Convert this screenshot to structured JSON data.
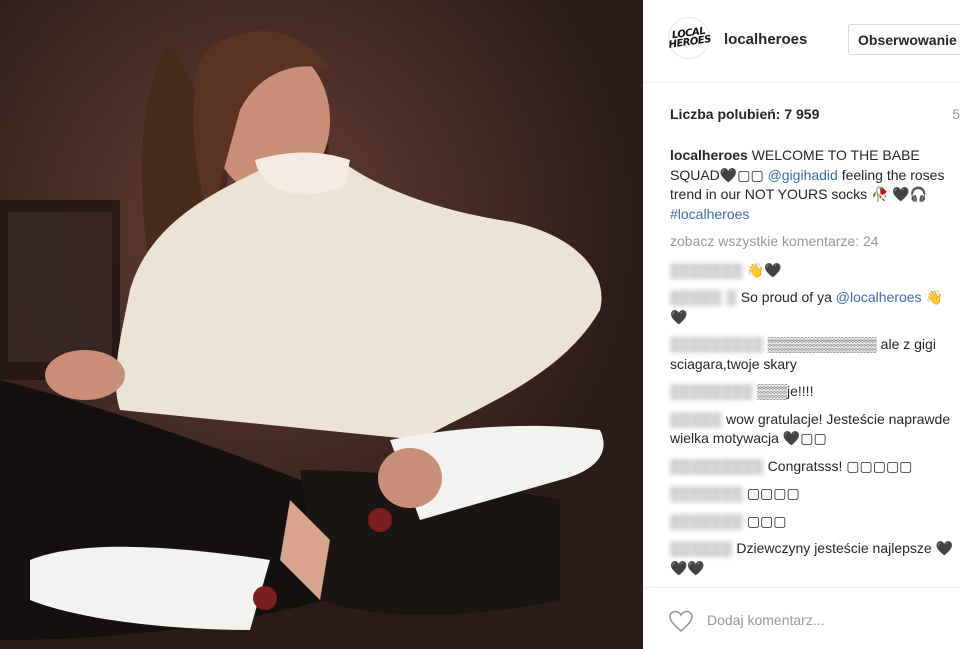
{
  "post": {
    "username": "localheroes",
    "avatar_text": "LOCAL HEROES",
    "follow_label": "Obserwowanie",
    "likes": "Liczba polubień: 7 959",
    "age": "5",
    "caption": {
      "user": "localheroes",
      "text_a": "WELCOME TO THE BABE SQUAD🖤▢▢ ",
      "mention": "@gigihadid",
      "text_b": " feeling the roses trend in our NOT YOURS socks 🥀 🖤🎧 ",
      "hashtag": "#localheroes"
    },
    "view_all": "zobacz wszystkie komentarze: 24",
    "comments": [
      {
        "user": "▒▒▒▒▒▒▒",
        "text": "👋🖤"
      },
      {
        "user": "▒▒▒▒▒ ▒",
        "text": "So proud of ya ",
        "mention": "@localheroes",
        "text_after": " 👋🖤"
      },
      {
        "user": "▒▒▒▒▒▒▒▒▒",
        "text": "▒▒▒▒▒▒▒▒▒▒▒ ale z gigi sciagara,twoje skary"
      },
      {
        "user": "▒▒▒▒▒▒▒▒",
        "text": "▒▒▒je!!!!"
      },
      {
        "user": "▒▒▒▒▒",
        "text": "wow gratulacje! Jesteście naprawde wielka motywacja 🖤▢▢"
      },
      {
        "user": "▒▒▒▒▒▒▒▒▒",
        "text": "Congratsss! ▢▢▢▢▢"
      },
      {
        "user": "▒▒▒▒▒▒▒",
        "text": "▢▢▢▢"
      },
      {
        "user": "▒▒▒▒▒▒▒",
        "text": "▢▢▢"
      },
      {
        "user": "▒▒▒▒▒▒",
        "text": "Dziewczyny jesteście najlepsze 🖤🖤🖤"
      }
    ],
    "add_comment_placeholder": "Dodaj komentarz..."
  }
}
